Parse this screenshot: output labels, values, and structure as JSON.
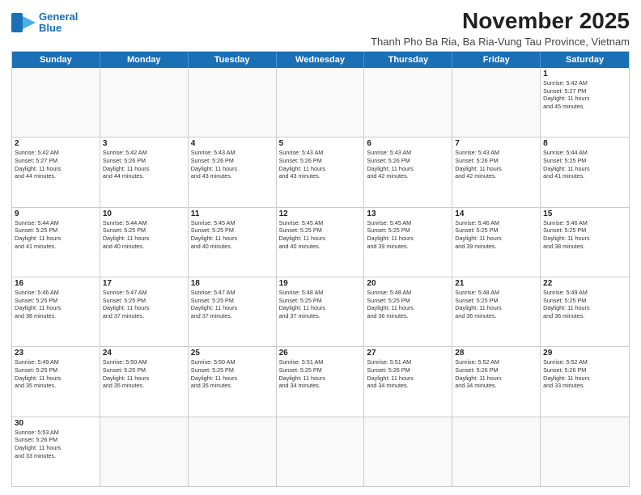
{
  "logo": {
    "line1": "General",
    "line2": "Blue"
  },
  "title": "November 2025",
  "subtitle": "Thanh Pho Ba Ria, Ba Ria-Vung Tau Province, Vietnam",
  "days_of_week": [
    "Sunday",
    "Monday",
    "Tuesday",
    "Wednesday",
    "Thursday",
    "Friday",
    "Saturday"
  ],
  "weeks": [
    [
      {
        "day": "",
        "text": ""
      },
      {
        "day": "",
        "text": ""
      },
      {
        "day": "",
        "text": ""
      },
      {
        "day": "",
        "text": ""
      },
      {
        "day": "",
        "text": ""
      },
      {
        "day": "",
        "text": ""
      },
      {
        "day": "1",
        "text": "Sunrise: 5:42 AM\nSunset: 5:27 PM\nDaylight: 11 hours\nand 45 minutes."
      }
    ],
    [
      {
        "day": "2",
        "text": "Sunrise: 5:42 AM\nSunset: 5:27 PM\nDaylight: 11 hours\nand 44 minutes."
      },
      {
        "day": "3",
        "text": "Sunrise: 5:42 AM\nSunset: 5:26 PM\nDaylight: 11 hours\nand 44 minutes."
      },
      {
        "day": "4",
        "text": "Sunrise: 5:43 AM\nSunset: 5:26 PM\nDaylight: 11 hours\nand 43 minutes."
      },
      {
        "day": "5",
        "text": "Sunrise: 5:43 AM\nSunset: 5:26 PM\nDaylight: 11 hours\nand 43 minutes."
      },
      {
        "day": "6",
        "text": "Sunrise: 5:43 AM\nSunset: 5:26 PM\nDaylight: 11 hours\nand 42 minutes."
      },
      {
        "day": "7",
        "text": "Sunrise: 5:43 AM\nSunset: 5:26 PM\nDaylight: 11 hours\nand 42 minutes."
      },
      {
        "day": "8",
        "text": "Sunrise: 5:44 AM\nSunset: 5:25 PM\nDaylight: 11 hours\nand 41 minutes."
      }
    ],
    [
      {
        "day": "9",
        "text": "Sunrise: 5:44 AM\nSunset: 5:25 PM\nDaylight: 11 hours\nand 41 minutes."
      },
      {
        "day": "10",
        "text": "Sunrise: 5:44 AM\nSunset: 5:25 PM\nDaylight: 11 hours\nand 40 minutes."
      },
      {
        "day": "11",
        "text": "Sunrise: 5:45 AM\nSunset: 5:25 PM\nDaylight: 11 hours\nand 40 minutes."
      },
      {
        "day": "12",
        "text": "Sunrise: 5:45 AM\nSunset: 5:25 PM\nDaylight: 11 hours\nand 40 minutes."
      },
      {
        "day": "13",
        "text": "Sunrise: 5:45 AM\nSunset: 5:25 PM\nDaylight: 11 hours\nand 39 minutes."
      },
      {
        "day": "14",
        "text": "Sunrise: 5:46 AM\nSunset: 5:25 PM\nDaylight: 11 hours\nand 39 minutes."
      },
      {
        "day": "15",
        "text": "Sunrise: 5:46 AM\nSunset: 5:25 PM\nDaylight: 11 hours\nand 38 minutes."
      }
    ],
    [
      {
        "day": "16",
        "text": "Sunrise: 5:46 AM\nSunset: 5:25 PM\nDaylight: 11 hours\nand 38 minutes."
      },
      {
        "day": "17",
        "text": "Sunrise: 5:47 AM\nSunset: 5:25 PM\nDaylight: 11 hours\nand 37 minutes."
      },
      {
        "day": "18",
        "text": "Sunrise: 5:47 AM\nSunset: 5:25 PM\nDaylight: 11 hours\nand 37 minutes."
      },
      {
        "day": "19",
        "text": "Sunrise: 5:48 AM\nSunset: 5:25 PM\nDaylight: 11 hours\nand 37 minutes."
      },
      {
        "day": "20",
        "text": "Sunrise: 5:48 AM\nSunset: 5:25 PM\nDaylight: 11 hours\nand 36 minutes."
      },
      {
        "day": "21",
        "text": "Sunrise: 5:48 AM\nSunset: 5:25 PM\nDaylight: 11 hours\nand 36 minutes."
      },
      {
        "day": "22",
        "text": "Sunrise: 5:49 AM\nSunset: 5:25 PM\nDaylight: 11 hours\nand 36 minutes."
      }
    ],
    [
      {
        "day": "23",
        "text": "Sunrise: 5:49 AM\nSunset: 5:25 PM\nDaylight: 11 hours\nand 35 minutes."
      },
      {
        "day": "24",
        "text": "Sunrise: 5:50 AM\nSunset: 5:25 PM\nDaylight: 11 hours\nand 35 minutes."
      },
      {
        "day": "25",
        "text": "Sunrise: 5:50 AM\nSunset: 5:25 PM\nDaylight: 11 hours\nand 35 minutes."
      },
      {
        "day": "26",
        "text": "Sunrise: 5:51 AM\nSunset: 5:25 PM\nDaylight: 11 hours\nand 34 minutes."
      },
      {
        "day": "27",
        "text": "Sunrise: 5:51 AM\nSunset: 5:26 PM\nDaylight: 11 hours\nand 34 minutes."
      },
      {
        "day": "28",
        "text": "Sunrise: 5:52 AM\nSunset: 5:26 PM\nDaylight: 11 hours\nand 34 minutes."
      },
      {
        "day": "29",
        "text": "Sunrise: 5:52 AM\nSunset: 5:26 PM\nDaylight: 11 hours\nand 33 minutes."
      }
    ],
    [
      {
        "day": "30",
        "text": "Sunrise: 5:53 AM\nSunset: 5:26 PM\nDaylight: 11 hours\nand 33 minutes."
      },
      {
        "day": "",
        "text": ""
      },
      {
        "day": "",
        "text": ""
      },
      {
        "day": "",
        "text": ""
      },
      {
        "day": "",
        "text": ""
      },
      {
        "day": "",
        "text": ""
      },
      {
        "day": "",
        "text": ""
      }
    ]
  ]
}
